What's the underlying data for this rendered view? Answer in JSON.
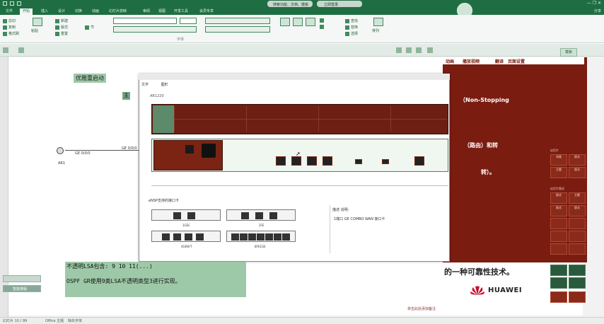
{
  "titlebar": {
    "search_hint": "搜索功能、文档、模板",
    "share_label": "分享",
    "login_label": "立即登录"
  },
  "ribbon_tabs": [
    "文件",
    "开始",
    "插入",
    "设计",
    "切换",
    "动画",
    "幻灯片放映",
    "审阅",
    "视图",
    "开发工具",
    "会员专享"
  ],
  "active_tab": "开始",
  "user_name": "分享",
  "ribbon": {
    "buttons": [
      "剪切",
      "复制",
      "格式刷",
      "粘贴",
      "新建",
      "版式",
      "重置",
      "节",
      "查找",
      "替换",
      "选择",
      "排列"
    ],
    "groups": [
      "剪贴板",
      "幻灯片",
      "字体",
      "段落",
      "绘图",
      "编辑"
    ],
    "panel_tab": "模板"
  },
  "slide": {
    "top_links": [
      "动画",
      "播放视频",
      "翻译",
      "页面设置"
    ],
    "caption": "优雅重启动",
    "plus": "主",
    "node_label": "AR1",
    "interface_left": "GE 0/0/0",
    "interface_right": "GE 0/0/0",
    "red_text_1": "（Non-Stopping",
    "red_text_2": "（路由）和转",
    "red_text_3": "转）。",
    "reliability_text": "的一种可靠性技术。",
    "logo_text": "HUAWEI",
    "green_line_1": "不透明LSA包含: 9 10 11(...)",
    "green_line_2": "OSPF GR使用9类LSA不透明类型3进行实现。",
    "notes_link": "单击此处添加备注"
  },
  "dialog": {
    "tabs": [
      "文字",
      "图形"
    ],
    "subtitle": "AR1220",
    "section_title": "eNSP支持的接口卡",
    "desc_label": "描述 说明:",
    "desc_text": "1端口 GE COMBO WAN 接口卡",
    "cards": [
      "1GEC",
      "2FE",
      "4GEW-T",
      "8FE1GE"
    ]
  },
  "right_grid": {
    "label_top": "幻灯片",
    "label_mid": "幻灯片版式",
    "cells": [
      "母版",
      "版式",
      "主题",
      "版式",
      "版式",
      "主题",
      "版式",
      "版式"
    ]
  },
  "widgets": {
    "mini1": "",
    "mini2": "智能排版"
  },
  "statusbar": {
    "left": "幻灯片 10 / 99",
    "theme": "Office 主题",
    "missing_font": "缺失字体"
  },
  "colors": {
    "brand_green": "#1f6e43",
    "slide_red": "#7a1c10",
    "highlight_green": "#9ec9a8"
  }
}
